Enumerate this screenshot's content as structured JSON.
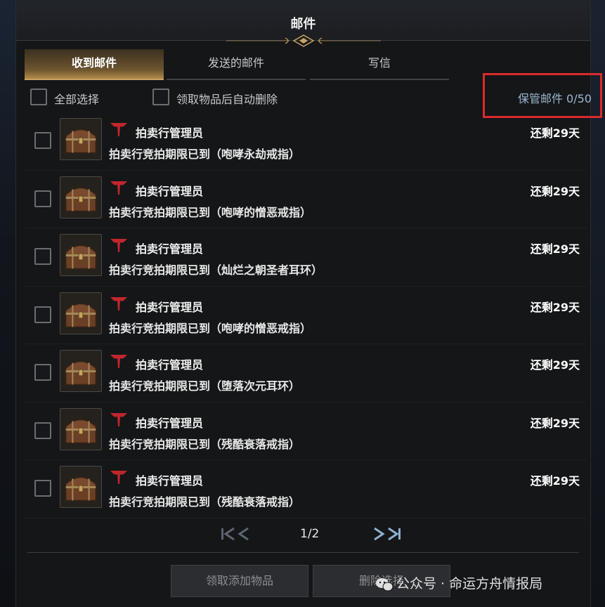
{
  "window": {
    "title": "邮件"
  },
  "tabs": [
    {
      "label": "收到邮件",
      "active": true
    },
    {
      "label": "发送的邮件",
      "active": false
    },
    {
      "label": "写信",
      "active": false
    }
  ],
  "options": {
    "select_all": "全部选择",
    "auto_delete": "领取物品后自动删除"
  },
  "storage": {
    "label": "保管邮件 0/50"
  },
  "mails": [
    {
      "sender": "拍卖行管理员",
      "subject": "拍卖行竞拍期限已到（咆哮永劫戒指）",
      "remaining": "还剩29天"
    },
    {
      "sender": "拍卖行管理员",
      "subject": "拍卖行竞拍期限已到（咆哮的憎恶戒指）",
      "remaining": "还剩29天"
    },
    {
      "sender": "拍卖行管理员",
      "subject": "拍卖行竞拍期限已到（灿烂之朝圣者耳环）",
      "remaining": "还剩29天"
    },
    {
      "sender": "拍卖行管理员",
      "subject": "拍卖行竞拍期限已到（咆哮的憎恶戒指）",
      "remaining": "还剩29天"
    },
    {
      "sender": "拍卖行管理员",
      "subject": "拍卖行竞拍期限已到（堕落次元耳环）",
      "remaining": "还剩29天"
    },
    {
      "sender": "拍卖行管理员",
      "subject": "拍卖行竞拍期限已到（残酷衰落戒指）",
      "remaining": "还剩29天"
    },
    {
      "sender": "拍卖行管理员",
      "subject": "拍卖行竞拍期限已到（残酷衰落戒指）",
      "remaining": "还剩29天"
    }
  ],
  "pagination": {
    "page": "1/2"
  },
  "buttons": {
    "claim": "领取添加物品",
    "delete": "删除选择"
  },
  "watermark": {
    "text": "公众号 · 命运方舟情报局"
  },
  "colors": {
    "accent_gold": "#c8a463",
    "highlight_red": "#d92b2b",
    "storage_text": "#9fb8cf",
    "logo_red": "#c0272d"
  },
  "icons": {
    "row_item": "treasure-chest-icon",
    "sender": "auction-logo-icon",
    "pager_first": "first-page-icon",
    "pager_prev": "prev-page-icon",
    "pager_next": "next-page-icon",
    "pager_last": "last-page-icon"
  }
}
